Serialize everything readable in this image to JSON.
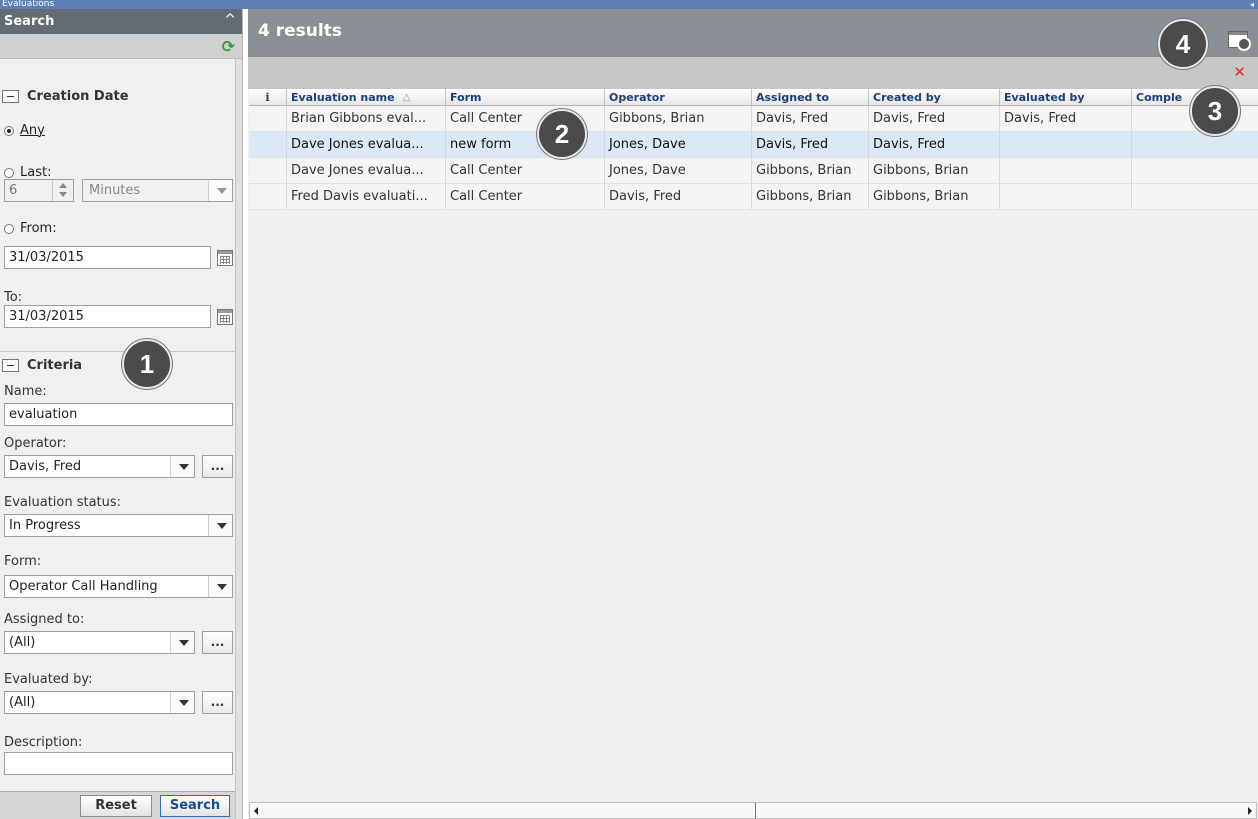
{
  "window": {
    "title": "Evaluations",
    "collapse_glyph": "◂"
  },
  "search_panel": {
    "header": "Search",
    "collapse_glyph": "^",
    "refresh_glyph": "⟳",
    "creation_date": {
      "title": "Creation Date",
      "any_label": "Any",
      "last_label": "Last:",
      "last_value": "6",
      "last_unit": "Minutes",
      "from_label": "From:",
      "from_value": "31/03/2015",
      "to_label": "To:",
      "to_value": "31/03/2015",
      "selected": "any"
    },
    "criteria": {
      "title": "Criteria",
      "name_label": "Name:",
      "name_value": "evaluation",
      "operator_label": "Operator:",
      "operator_value": "Davis, Fred",
      "status_label": "Evaluation status:",
      "status_value": "In Progress",
      "form_label": "Form:",
      "form_value": "Operator Call Handling",
      "assigned_label": "Assigned to:",
      "assigned_value": "(All)",
      "evaluated_label": "Evaluated by:",
      "evaluated_value": "(All)",
      "description_label": "Description:",
      "description_value": ""
    },
    "ellipsis": "...",
    "reset_label": "Reset",
    "search_label": "Search"
  },
  "results": {
    "header": "4 results",
    "close_glyph": "✕",
    "columns": [
      "i",
      "Evaluation name",
      "Form",
      "Operator",
      "Assigned to",
      "Created by",
      "Evaluated by",
      "Comple"
    ],
    "sort_glyph": "△",
    "rows": [
      {
        "name": "Brian Gibbons eval...",
        "form": "Call Center",
        "operator": "Gibbons, Brian",
        "assigned": "Davis, Fred",
        "created": "Davis, Fred",
        "evaluated": "Davis, Fred",
        "completed": ""
      },
      {
        "name": "Dave Jones evalua...",
        "form": "new form",
        "operator": "Jones, Dave",
        "assigned": "Davis, Fred",
        "created": "Davis, Fred",
        "evaluated": "",
        "completed": ""
      },
      {
        "name": "Dave Jones evalua...",
        "form": "Call Center",
        "operator": "Jones, Dave",
        "assigned": "Gibbons, Brian",
        "created": "Gibbons, Brian",
        "evaluated": "",
        "completed": ""
      },
      {
        "name": "Fred Davis evaluati...",
        "form": "Call Center",
        "operator": "Davis, Fred",
        "assigned": "Gibbons, Brian",
        "created": "Gibbons, Brian",
        "evaluated": "",
        "completed": ""
      }
    ],
    "selected_row": 1
  },
  "callouts": [
    "1",
    "2",
    "3",
    "4"
  ],
  "colors": {
    "accent": "#5c7fb4",
    "selected_row": "#dbe8f7",
    "close": "#e03030",
    "refresh": "#3a9c3a"
  }
}
